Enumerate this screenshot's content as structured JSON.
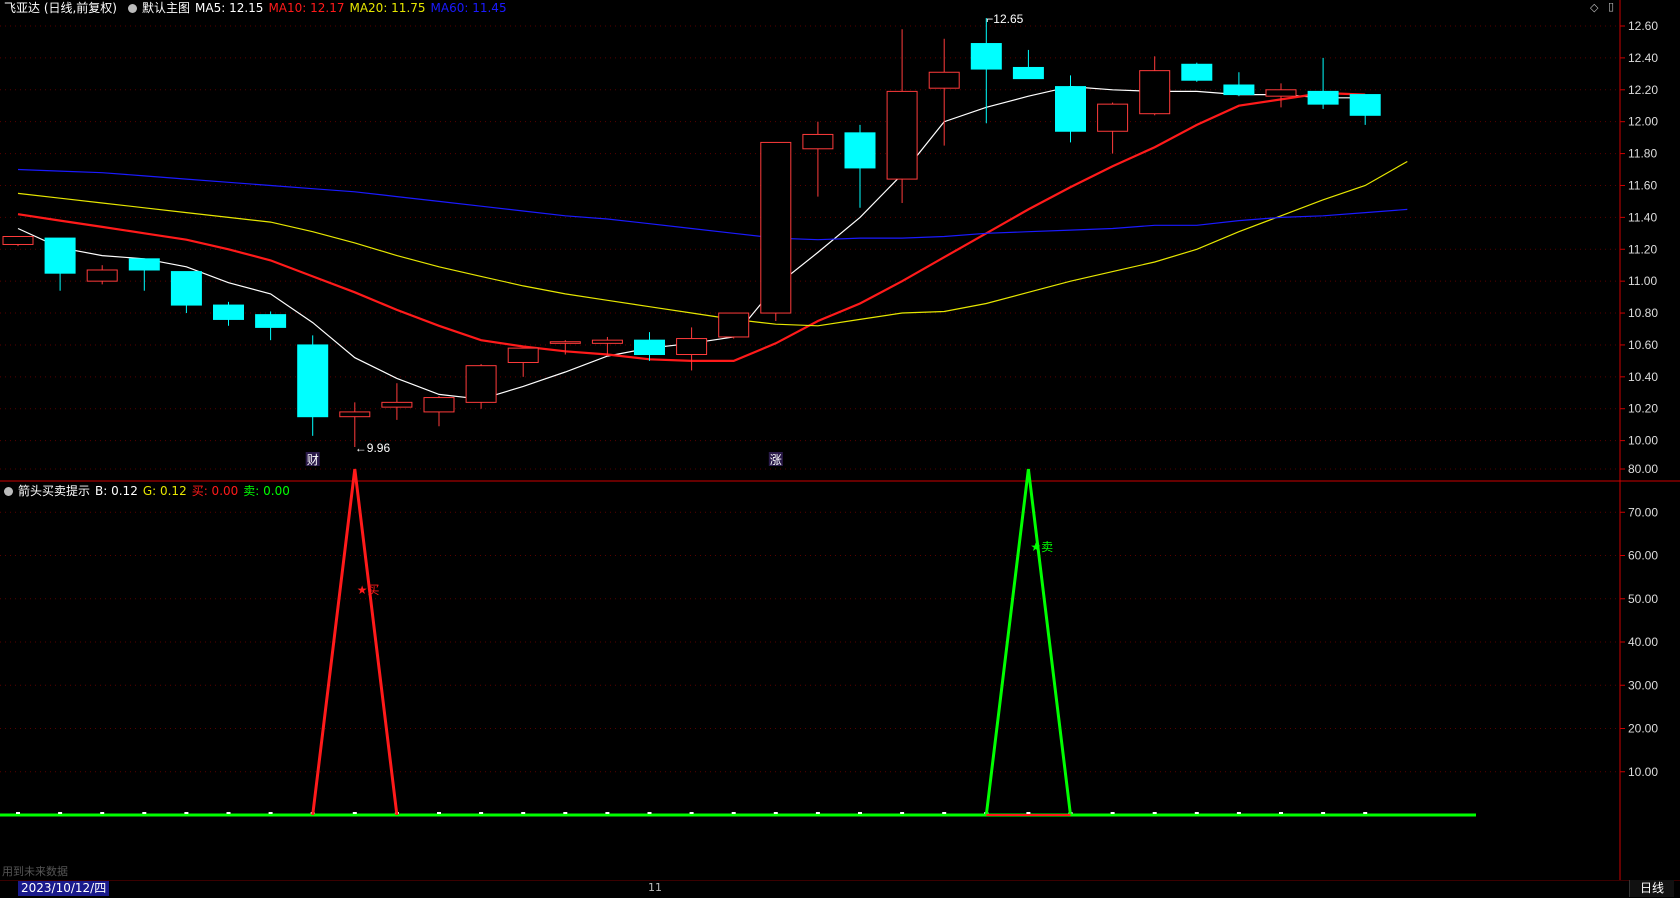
{
  "main_header": {
    "stock": "飞亚达 (日线,前复权)",
    "chart_name": "默认主图",
    "ma5": "MA5: 12.15",
    "ma10": "MA10: 12.17",
    "ma20": "MA20: 11.75",
    "ma60": "MA60: 11.45"
  },
  "sub_header": {
    "name": "箭头买卖提示",
    "b": "B: 0.12",
    "g": "G: 0.12",
    "buy": "买: 0.00",
    "sell": "卖: 0.00"
  },
  "footer": {
    "date": "2023/10/12/四",
    "month_label": "11",
    "period": "日线",
    "ghost_text": "用到未来数据"
  },
  "colors": {
    "up": "#ff3b3b",
    "down": "#00ffff",
    "ma5": "#ffffff",
    "ma10": "#ff1a1a",
    "ma20": "#e6e600",
    "ma60": "#1a1aff",
    "axis": "#cc0000",
    "buy": "#ff1a1a",
    "sell": "#00ff00"
  },
  "chart_data": [
    {
      "type": "candlestick",
      "title": "飞亚达 (日线,前复权)",
      "ylim": [
        10.0,
        12.6
      ],
      "yticks": [
        "12.60",
        "12.40",
        "12.20",
        "12.00",
        "11.80",
        "11.60",
        "11.40",
        "11.20",
        "11.00",
        "10.80",
        "10.60",
        "10.40",
        "10.20",
        "10.00"
      ],
      "candles": [
        {
          "o": 11.23,
          "h": 11.28,
          "l": 11.22,
          "c": 11.28
        },
        {
          "o": 11.27,
          "h": 11.27,
          "l": 10.94,
          "c": 11.05
        },
        {
          "o": 11.0,
          "h": 11.1,
          "l": 10.98,
          "c": 11.07
        },
        {
          "o": 11.14,
          "h": 11.14,
          "l": 10.94,
          "c": 11.07
        },
        {
          "o": 11.06,
          "h": 11.06,
          "l": 10.8,
          "c": 10.85
        },
        {
          "o": 10.85,
          "h": 10.87,
          "l": 10.72,
          "c": 10.76
        },
        {
          "o": 10.79,
          "h": 10.81,
          "l": 10.63,
          "c": 10.71
        },
        {
          "o": 10.6,
          "h": 10.66,
          "l": 10.03,
          "c": 10.15
        },
        {
          "o": 10.15,
          "h": 10.24,
          "l": 9.96,
          "c": 10.18
        },
        {
          "o": 10.21,
          "h": 10.36,
          "l": 10.13,
          "c": 10.24
        },
        {
          "o": 10.18,
          "h": 10.28,
          "l": 10.09,
          "c": 10.27
        },
        {
          "o": 10.24,
          "h": 10.48,
          "l": 10.2,
          "c": 10.47
        },
        {
          "o": 10.49,
          "h": 10.58,
          "l": 10.4,
          "c": 10.58
        },
        {
          "o": 10.61,
          "h": 10.63,
          "l": 10.54,
          "c": 10.62
        },
        {
          "o": 10.61,
          "h": 10.65,
          "l": 10.53,
          "c": 10.63
        },
        {
          "o": 10.63,
          "h": 10.68,
          "l": 10.5,
          "c": 10.54
        },
        {
          "o": 10.54,
          "h": 10.71,
          "l": 10.44,
          "c": 10.64
        },
        {
          "o": 10.65,
          "h": 10.8,
          "l": 10.64,
          "c": 10.8
        },
        {
          "o": 10.8,
          "h": 11.87,
          "l": 10.75,
          "c": 11.87
        },
        {
          "o": 11.83,
          "h": 12.0,
          "l": 11.53,
          "c": 11.92
        },
        {
          "o": 11.93,
          "h": 11.98,
          "l": 11.46,
          "c": 11.71
        },
        {
          "o": 11.64,
          "h": 12.58,
          "l": 11.49,
          "c": 12.19
        },
        {
          "o": 12.21,
          "h": 12.52,
          "l": 11.85,
          "c": 12.31
        },
        {
          "o": 12.49,
          "h": 12.65,
          "l": 11.99,
          "c": 12.33
        },
        {
          "o": 12.34,
          "h": 12.45,
          "l": 12.27,
          "c": 12.27
        },
        {
          "o": 12.22,
          "h": 12.29,
          "l": 11.87,
          "c": 11.94
        },
        {
          "o": 11.94,
          "h": 12.12,
          "l": 11.8,
          "c": 12.11
        },
        {
          "o": 12.05,
          "h": 12.41,
          "l": 12.04,
          "c": 12.32
        },
        {
          "o": 12.36,
          "h": 12.37,
          "l": 12.25,
          "c": 12.26
        },
        {
          "o": 12.23,
          "h": 12.31,
          "l": 12.16,
          "c": 12.17
        },
        {
          "o": 12.16,
          "h": 12.24,
          "l": 12.09,
          "c": 12.2
        },
        {
          "o": 12.19,
          "h": 12.4,
          "l": 12.08,
          "c": 12.11
        },
        {
          "o": 12.17,
          "h": 12.17,
          "l": 11.98,
          "c": 12.04
        }
      ],
      "series": [
        {
          "name": "MA5",
          "values": [
            11.33,
            11.21,
            11.16,
            11.14,
            11.09,
            10.99,
            10.92,
            10.74,
            10.52,
            10.39,
            10.29,
            10.26,
            10.34,
            10.43,
            10.53,
            10.58,
            10.61,
            10.65,
            10.97,
            11.18,
            11.4,
            11.67,
            12.0,
            12.09,
            12.16,
            12.22,
            12.2,
            12.19,
            12.19,
            12.17,
            12.17,
            12.15,
            12.15
          ]
        },
        {
          "name": "MA10",
          "values": [
            11.42,
            11.38,
            11.34,
            11.3,
            11.26,
            11.2,
            11.13,
            11.03,
            10.93,
            10.82,
            10.72,
            10.63,
            10.59,
            10.56,
            10.54,
            10.51,
            10.5,
            10.5,
            10.61,
            10.75,
            10.86,
            11.0,
            11.15,
            11.3,
            11.45,
            11.59,
            11.72,
            11.84,
            11.98,
            12.1,
            12.14,
            12.18,
            12.17
          ]
        },
        {
          "name": "MA20",
          "values": [
            11.55,
            11.52,
            11.49,
            11.46,
            11.43,
            11.4,
            11.37,
            11.31,
            11.24,
            11.16,
            11.09,
            11.03,
            10.97,
            10.92,
            10.88,
            10.84,
            10.8,
            10.76,
            10.73,
            10.72,
            10.76,
            10.8,
            10.81,
            10.86,
            10.93,
            11.0,
            11.06,
            11.12,
            11.2,
            11.31,
            11.41,
            11.51,
            11.6,
            11.75
          ]
        },
        {
          "name": "MA60",
          "values": [
            11.7,
            11.69,
            11.68,
            11.66,
            11.64,
            11.62,
            11.6,
            11.58,
            11.56,
            11.53,
            11.5,
            11.47,
            11.44,
            11.41,
            11.39,
            11.36,
            11.33,
            11.3,
            11.27,
            11.26,
            11.27,
            11.27,
            11.28,
            11.3,
            11.31,
            11.32,
            11.33,
            11.35,
            11.35,
            11.38,
            11.4,
            11.41,
            11.43,
            11.45
          ]
        }
      ],
      "annotations": [
        {
          "label": "12.65",
          "candle": 23,
          "value": 12.65
        },
        {
          "label": "9.96",
          "candle": 8,
          "value": 9.96
        }
      ],
      "event_markers": [
        {
          "label": "财",
          "candle": 7
        },
        {
          "label": "涨",
          "candle": 18
        }
      ]
    },
    {
      "type": "line",
      "title": "箭头买卖提示",
      "ylim": [
        0,
        82
      ],
      "yticks": [
        "80.00",
        "70.00",
        "60.00",
        "50.00",
        "40.00",
        "30.00",
        "20.00",
        "10.00"
      ],
      "series": [
        {
          "name": "买",
          "values": [
            0,
            0,
            0,
            0,
            0,
            0,
            0,
            0,
            80,
            0,
            0,
            0,
            0,
            0,
            0,
            0,
            0,
            0,
            0,
            0,
            0,
            0,
            0,
            0,
            0,
            0,
            0,
            0,
            0,
            0,
            0,
            0,
            0
          ]
        },
        {
          "name": "卖",
          "values": [
            0,
            0,
            0,
            0,
            0,
            0,
            0,
            0,
            0,
            0,
            0,
            0,
            0,
            0,
            0,
            0,
            0,
            0,
            0,
            0,
            0,
            0,
            0,
            0,
            80,
            0,
            0,
            0,
            0,
            0,
            0,
            0,
            0
          ]
        }
      ],
      "markers": [
        {
          "label": "买",
          "candle": 8,
          "value": 52
        },
        {
          "label": "卖",
          "candle": 24,
          "value": 62
        }
      ]
    }
  ]
}
